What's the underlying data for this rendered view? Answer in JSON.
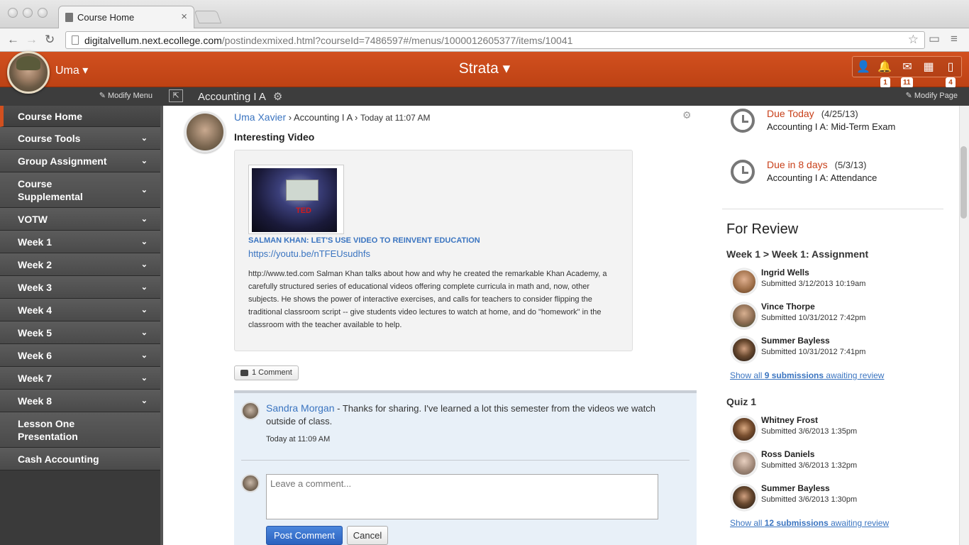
{
  "browser": {
    "tab_title": "Course Home",
    "url_host": "digitalvellum.next.ecollege.com",
    "url_path": "/postindexmixed.html?courseId=7486597#/menus/1000012605377/items/10041"
  },
  "header": {
    "user_name": "Uma ▾",
    "app_title": "Strata ▾",
    "badges": {
      "notifications": "1",
      "messages": "11",
      "documents": "4"
    }
  },
  "toolbar": {
    "modify_menu": "Modify Menu",
    "course_name": "Accounting I A",
    "modify_page": "Modify Page"
  },
  "sidebar": {
    "items": [
      {
        "label": "Course Home"
      },
      {
        "label": "Course Tools"
      },
      {
        "label": "Group Assignment"
      },
      {
        "label": "Course Supplemental"
      },
      {
        "label": "VOTW"
      },
      {
        "label": "Week 1"
      },
      {
        "label": "Week 2"
      },
      {
        "label": "Week 3"
      },
      {
        "label": "Week 4"
      },
      {
        "label": "Week 5"
      },
      {
        "label": "Week 6"
      },
      {
        "label": "Week 7"
      },
      {
        "label": "Week 8"
      },
      {
        "label": "Lesson One Presentation"
      },
      {
        "label": "Cash Accounting"
      }
    ]
  },
  "post": {
    "author": "Uma Xavier",
    "course": "Accounting I A",
    "time": "Today at 11:07 AM",
    "title": "Interesting Video",
    "video_title": "SALMAN KHAN: LET'S USE VIDEO TO REINVENT EDUCATION",
    "video_link": "https://youtu.be/nTFEUsudhfs",
    "description": "http://www.ted.com Salman Khan talks about how and why he created the remarkable Khan Academy, a carefully structured series of educational videos offering complete curricula in math and, now, other subjects. He shows the power of interactive exercises, and calls for teachers to consider flipping the traditional classroom script -- give students video lectures to watch at home, and do \"homework\" in the classroom with the teacher available to help.",
    "comment_count_label": "1 Comment"
  },
  "comment": {
    "author": "Sandra Morgan",
    "text": "- Thanks for sharing. I've learned a lot this semester from the videos we watch outside of class.",
    "time": "Today at 11:09 AM",
    "placeholder": "Leave a comment...",
    "post_label": "Post Comment",
    "cancel_label": "Cancel"
  },
  "due": [
    {
      "status": "Due Today",
      "date": "(4/25/13)",
      "title": "Accounting I A: Mid-Term Exam"
    },
    {
      "status": "Due in 8 days",
      "date": "(5/3/13)",
      "title": "Accounting I A: Attendance"
    }
  ],
  "review": {
    "heading": "For Review",
    "groups": [
      {
        "title": "Week 1 > Week 1: Assignment",
        "items": [
          {
            "name": "Ingrid Wells",
            "submitted": "Submitted 3/12/2013 10:19am"
          },
          {
            "name": "Vince Thorpe",
            "submitted": "Submitted 10/31/2012 7:42pm"
          },
          {
            "name": "Summer Bayless",
            "submitted": "Submitted 10/31/2012 7:41pm"
          }
        ],
        "link_pre": "Show all ",
        "link_bold": "9 submissions",
        "link_post": " awaiting review"
      },
      {
        "title": "Quiz 1",
        "items": [
          {
            "name": "Whitney Frost",
            "submitted": "Submitted 3/6/2013 1:35pm"
          },
          {
            "name": "Ross Daniels",
            "submitted": "Submitted 3/6/2013 1:32pm"
          },
          {
            "name": "Summer Bayless",
            "submitted": "Submitted 3/6/2013 1:30pm"
          }
        ],
        "link_pre": "Show all ",
        "link_bold": "12 submissions",
        "link_post": " awaiting review"
      }
    ]
  },
  "colors": {
    "accent": "#c8481a",
    "link": "#3a74c0",
    "sidebar": "#4a4a4a"
  }
}
